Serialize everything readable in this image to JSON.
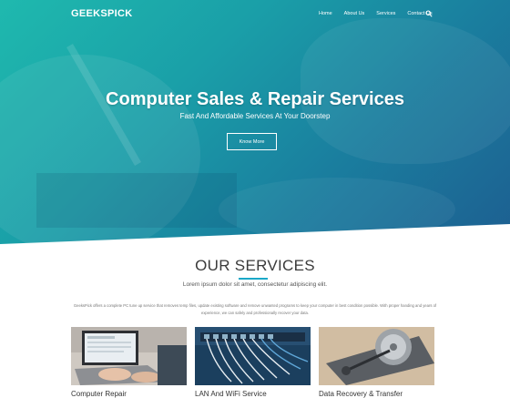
{
  "brand": {
    "name": "GEEKSPICK"
  },
  "nav": {
    "items": [
      {
        "label": "Home"
      },
      {
        "label": "About Us"
      },
      {
        "label": "Services"
      },
      {
        "label": "Contact Us"
      }
    ]
  },
  "hero": {
    "title": "Computer Sales & Repair Services",
    "subtitle": "Fast And Affordable Services At Your Doorstep",
    "button": "Know More"
  },
  "services": {
    "title": "OUR SERVICES",
    "subtitle": "Lorem ipsum dolor sit amet, consectetur adipiscing elit.",
    "description": "GeeksPick offers a complete PC tune up service that removes temp files, update existing software and remove unwanted programs to keep your computer in best condition possible. With proper handing and years of experience, we can safely and professionally recover your data.",
    "cards": [
      {
        "label": "Computer Repair"
      },
      {
        "label": "LAN And WiFi Service"
      },
      {
        "label": "Data Recovery & Transfer"
      }
    ]
  },
  "colors": {
    "accent": "#1aa8c8",
    "hero_start": "#1fb9ae",
    "hero_end": "#1d5f91"
  }
}
